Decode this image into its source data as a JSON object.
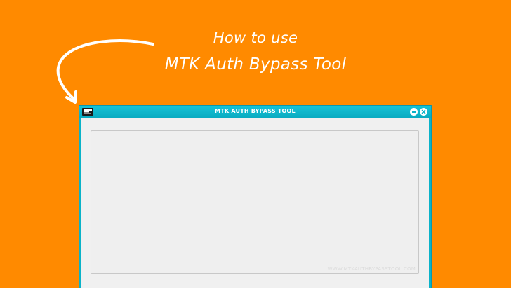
{
  "banner": {
    "line1": "How to use",
    "line2": "MTK Auth Bypass Tool"
  },
  "window": {
    "title": "MTK AUTH BYPASS TOOL",
    "watermark": "WWW.MTKAUTHBYPASSTOOL.COM"
  },
  "colors": {
    "background": "#FF8A00",
    "titlebar": "#0AB3C9",
    "client": "#F0F0F0",
    "text": "#FFFFFF"
  },
  "icons": {
    "logo": "app-logo-icon",
    "minimize": "minimize-icon",
    "close": "close-icon",
    "arrow": "curved-arrow-icon"
  }
}
